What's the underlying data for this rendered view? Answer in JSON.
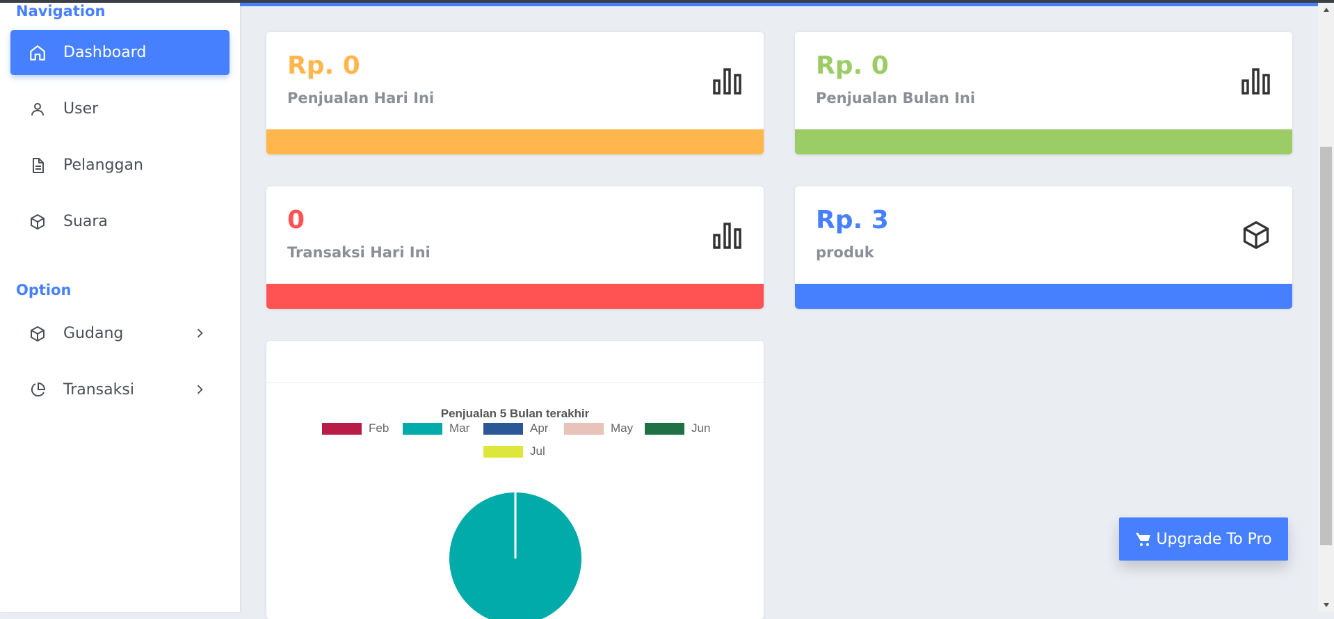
{
  "sidebar": {
    "navigation_title": "Navigation",
    "option_title": "Option",
    "nav_items": [
      {
        "label": "Dashboard",
        "icon": "home-icon",
        "active": true
      },
      {
        "label": "User",
        "icon": "user-icon"
      },
      {
        "label": "Pelanggan",
        "icon": "file-text-icon"
      },
      {
        "label": "Suara",
        "icon": "box-icon"
      }
    ],
    "option_items": [
      {
        "label": "Gudang",
        "icon": "box-icon",
        "has_submenu": true
      },
      {
        "label": "Transaksi",
        "icon": "pie-chart-icon",
        "has_submenu": true
      }
    ]
  },
  "stats": [
    {
      "value": "Rp. 0",
      "label": "Penjualan Hari Ini",
      "color": "#ffb64d",
      "icon": "bar-chart-icon"
    },
    {
      "value": "Rp. 0",
      "label": "Penjualan Bulan Ini",
      "color": "#9ccc65",
      "icon": "bar-chart-icon"
    },
    {
      "value": "0",
      "label": "Transaksi Hari Ini",
      "color": "#ff5252",
      "icon": "bar-chart-icon"
    },
    {
      "value": "Rp. 3",
      "label": "produk",
      "color": "#4680ff",
      "icon": "box-icon"
    }
  ],
  "chart_data": {
    "type": "pie",
    "title": "Penjualan 5 Bulan terakhir",
    "categories": [
      "Feb",
      "Mar",
      "Apr",
      "May",
      "Jun",
      "Jul"
    ],
    "colors": [
      "#b91d47",
      "#00aba9",
      "#2b5797",
      "#e8c3b9",
      "#1e7145",
      "#dce63b"
    ],
    "values": [
      0,
      100,
      0,
      0,
      0,
      0
    ],
    "legend_position": "top"
  },
  "upgrade_button": {
    "label": "Upgrade To Pro"
  },
  "colors": {
    "accent": "#4680ff"
  }
}
